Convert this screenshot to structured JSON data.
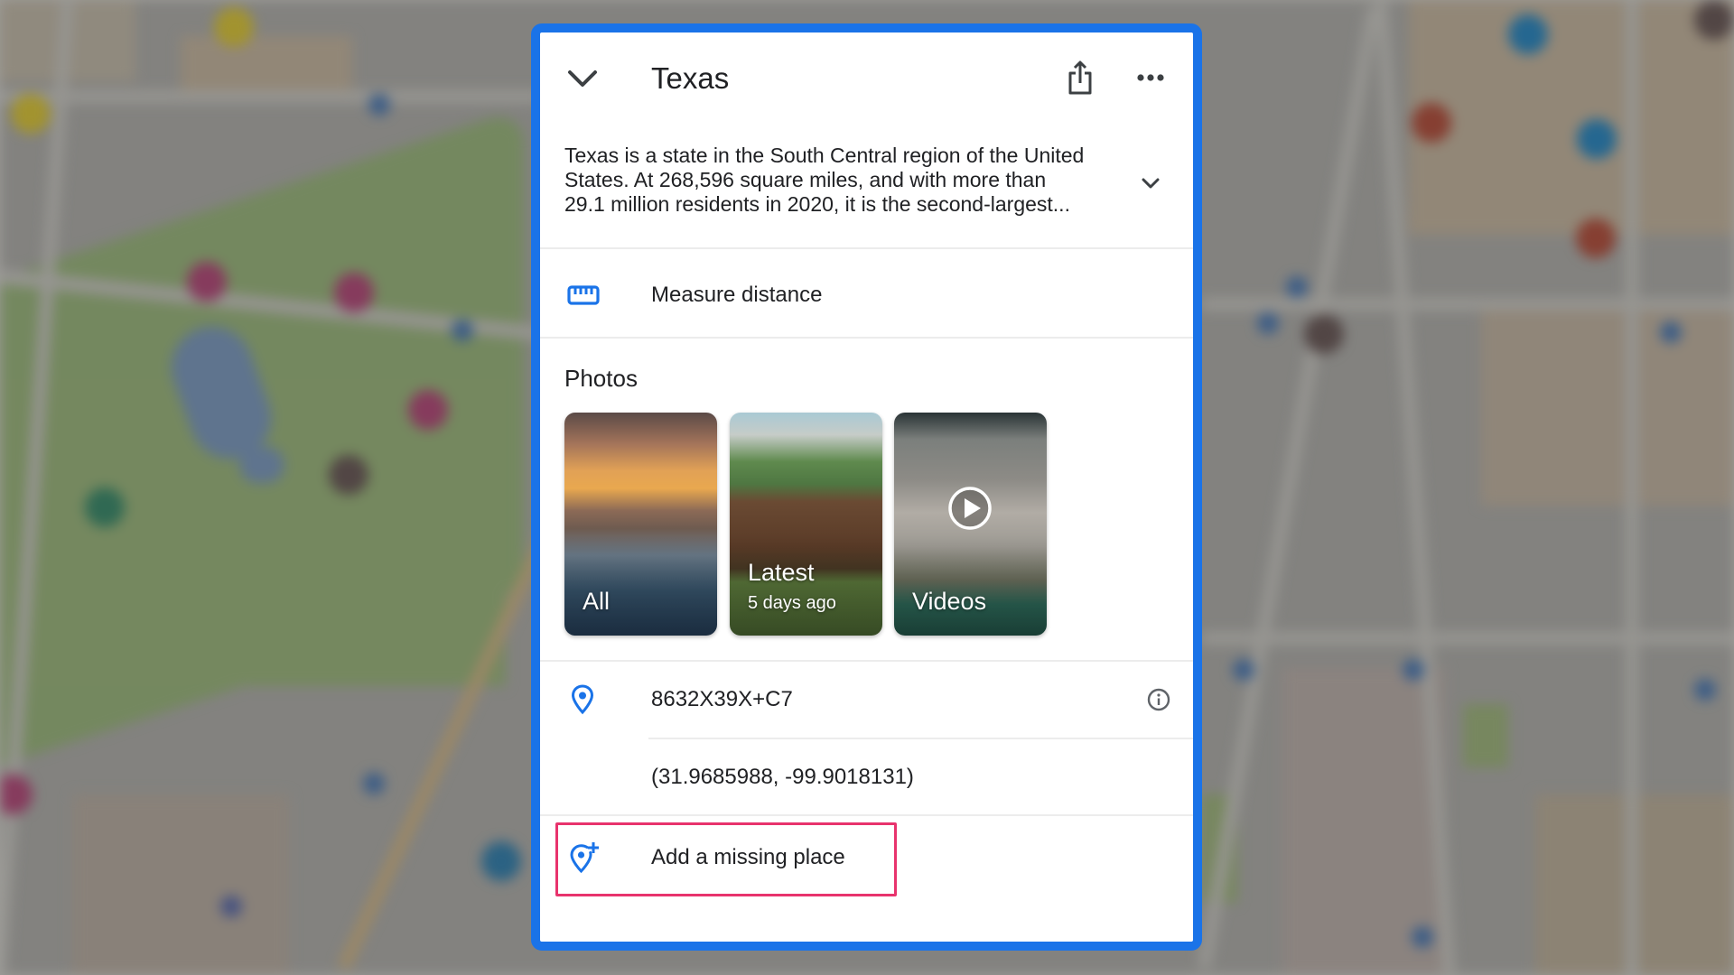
{
  "panel": {
    "title": "Texas",
    "header_icons": {
      "collapse": "chevron-down-icon",
      "share": "share-icon",
      "more": "more-horizontal-icon"
    },
    "description": {
      "lines": [
        "Texas is a state in the South Central region of the United",
        "States. At 268,596 square miles, and with more than",
        "29.1 million residents in 2020, it is the second-largest..."
      ],
      "expand_icon": "chevron-down-icon"
    },
    "measure_distance": {
      "label": "Measure distance",
      "icon": "ruler-icon"
    },
    "photos": {
      "heading": "Photos",
      "cards": [
        {
          "label": "All",
          "sub": ""
        },
        {
          "label": "Latest",
          "sub": "5 days ago"
        },
        {
          "label": "Videos",
          "sub": "",
          "icon": "play-icon"
        }
      ]
    },
    "plus_code": {
      "value": "8632X39X+C7",
      "icon": "location-pin-icon",
      "info_icon": "info-icon"
    },
    "coordinates": {
      "value": "(31.9685988, -99.9018131)"
    },
    "add_missing_place": {
      "label": "Add a missing place",
      "icon": "add-location-icon",
      "highlighted": true
    }
  },
  "colors": {
    "accent_blue": "#1a73e8",
    "highlight_pink": "#e8336d",
    "text_primary": "#202124",
    "icon_gray": "#3c4043"
  }
}
